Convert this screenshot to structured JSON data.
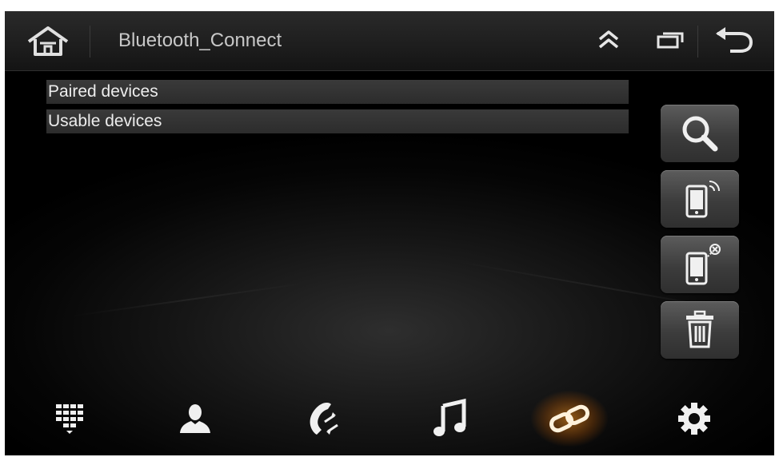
{
  "header": {
    "title": "Bluetooth_Connect",
    "icons": [
      "home-icon",
      "chevron-up-icon",
      "recent-apps-icon",
      "back-icon"
    ]
  },
  "lists": {
    "paired_label": "Paired devices",
    "usable_label": "Usable devices"
  },
  "side_actions": [
    {
      "id": "search",
      "icon": "search-icon"
    },
    {
      "id": "connect",
      "icon": "phone-signal-icon"
    },
    {
      "id": "disconnect",
      "icon": "phone-disconnect-icon"
    },
    {
      "id": "delete",
      "icon": "trash-icon"
    }
  ],
  "nav": {
    "items": [
      "dialpad-icon",
      "contacts-icon",
      "call-log-icon",
      "music-icon",
      "link-icon",
      "settings-icon"
    ],
    "active": "link-icon"
  },
  "colors": {
    "accent": "#f2a23a",
    "text": "#ededed",
    "title_text": "#c8c8c8"
  }
}
